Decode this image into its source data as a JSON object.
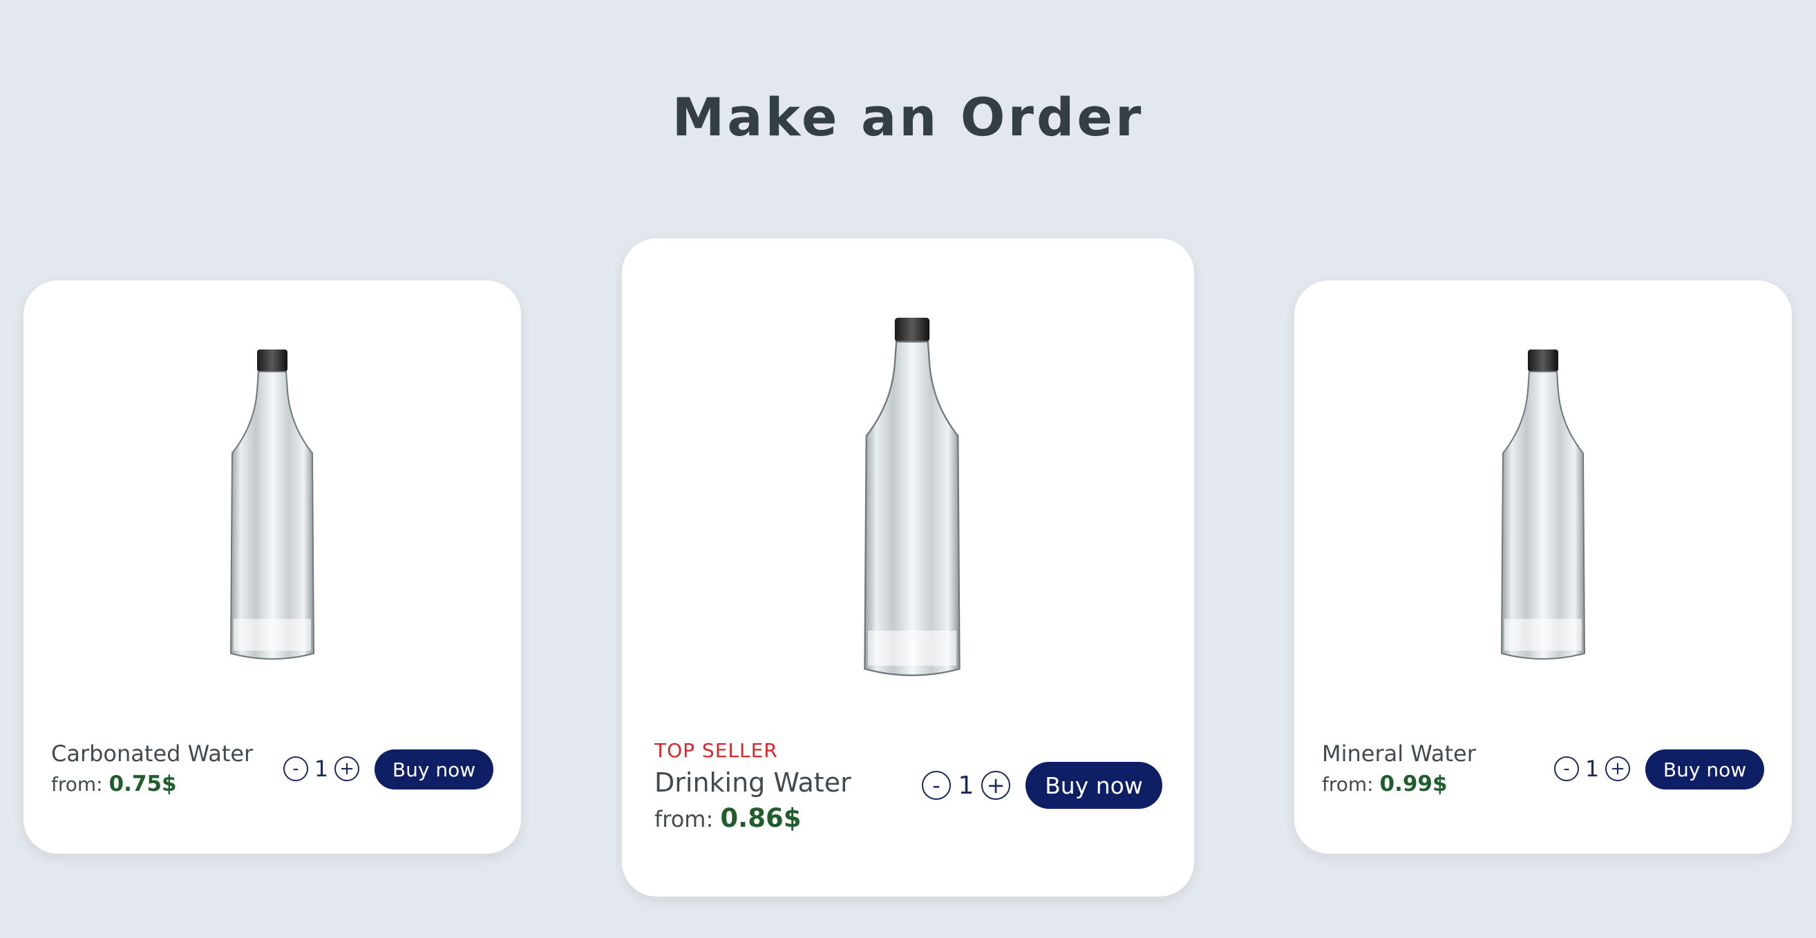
{
  "page": {
    "title": "Make an Order"
  },
  "products": [
    {
      "badge": "",
      "name": "Carbonated Water",
      "from_label": "from:",
      "price": "0.75$",
      "quantity": "1",
      "minus": "-",
      "plus": "+",
      "buy_label": "Buy now"
    },
    {
      "badge": "TOP SELLER",
      "name": "Drinking Water",
      "from_label": "from:",
      "price": "0.86$",
      "quantity": "1",
      "minus": "-",
      "plus": "+",
      "buy_label": "Buy now"
    },
    {
      "badge": "",
      "name": "Mineral Water",
      "from_label": "from:",
      "price": "0.99$",
      "quantity": "1",
      "minus": "-",
      "plus": "+",
      "buy_label": "Buy now"
    }
  ],
  "colors": {
    "background": "#e3e8ee",
    "card": "#ffffff",
    "button": "#0e1f66",
    "price": "#1f5e2c",
    "badge": "#d8262b",
    "title": "#343f44"
  },
  "icons": {
    "product_image": "water-bottle-icon"
  }
}
